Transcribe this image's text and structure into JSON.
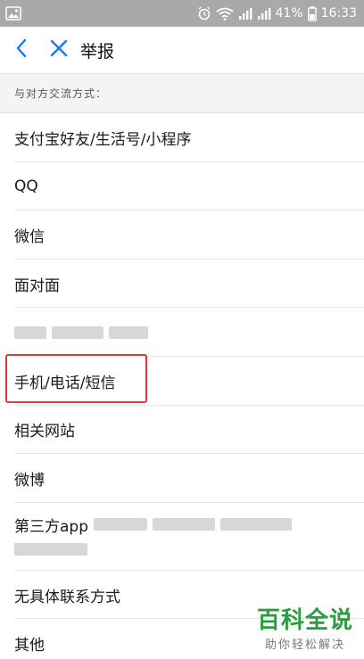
{
  "status_bar": {
    "battery_percent": "41%",
    "time": "16:33"
  },
  "nav": {
    "title": "举报",
    "back_icon": "chevron-left-icon",
    "close_icon": "close-icon"
  },
  "section": {
    "header": "与对方交流方式："
  },
  "list": {
    "items": [
      {
        "label": "支付宝好友/生活号/小程序"
      },
      {
        "label": "QQ"
      },
      {
        "label": "微信"
      },
      {
        "label": "面对面"
      },
      {
        "label": ""
      },
      {
        "label": "手机/电话/短信"
      },
      {
        "label": "相关网站"
      },
      {
        "label": "微博"
      },
      {
        "label": "第三方app"
      },
      {
        "label": "无具体联系方式"
      },
      {
        "label": "其他"
      }
    ]
  },
  "watermark": {
    "main": "百科全说",
    "sub": "助你轻松解决"
  },
  "colors": {
    "accent": "#1677ff",
    "highlight": "#e23a3a",
    "watermark_green": "#2a9d3c"
  }
}
